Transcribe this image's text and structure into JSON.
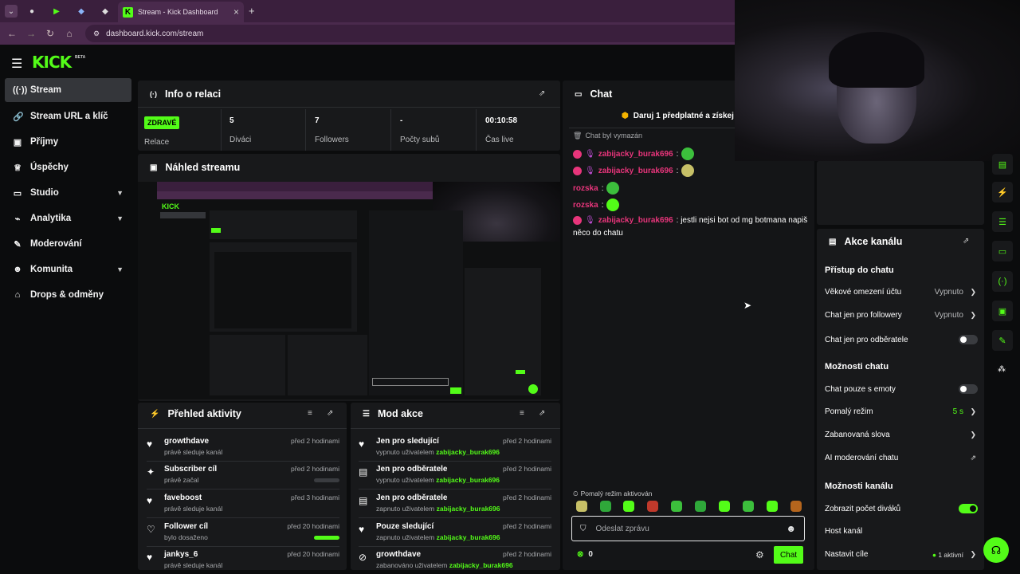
{
  "browser": {
    "tab_title": "Stream - Kick Dashboard",
    "url": "dashboard.kick.com/stream",
    "new_tab": "+",
    "close_tab": "×"
  },
  "app": {
    "logo": "KICK",
    "beta": "BETA"
  },
  "sidebar": {
    "items": [
      {
        "label": "Stream",
        "icon": "broadcast-icon"
      },
      {
        "label": "Stream URL a klíč",
        "icon": "link-icon"
      },
      {
        "label": "Příjmy",
        "icon": "wallet-icon"
      },
      {
        "label": "Úspěchy",
        "icon": "trophy-icon"
      },
      {
        "label": "Studio",
        "icon": "studio-icon"
      },
      {
        "label": "Analytika",
        "icon": "chart-icon"
      },
      {
        "label": "Moderování",
        "icon": "wrench-icon"
      },
      {
        "label": "Komunita",
        "icon": "people-icon"
      },
      {
        "label": "Drops & odměny",
        "icon": "gift-icon"
      }
    ]
  },
  "info": {
    "title": "Info o relaci",
    "status": "ZDRAVÉ",
    "status_label": "Relace",
    "stats": [
      {
        "value": "5",
        "label": "Diváci"
      },
      {
        "value": "7",
        "label": "Followers"
      },
      {
        "value": "-",
        "label": "Počty subů"
      },
      {
        "value": "00:10:58",
        "label": "Čas live"
      }
    ]
  },
  "preview": {
    "title": "Náhled streamu"
  },
  "activity": {
    "title": "Přehled aktivity",
    "rows": [
      {
        "title": "growthdave",
        "sub": "právě sleduje kanál",
        "time": "před 2 hodinami"
      },
      {
        "title": "Subscriber cíl",
        "sub": "právě začal",
        "time": "před 2 hodinami"
      },
      {
        "title": "faveboost",
        "sub": "právě sleduje kanál",
        "time": "před 3 hodinami"
      },
      {
        "title": "Follower cíl",
        "sub": "bylo dosaženo",
        "time": "před 20 hodinami"
      },
      {
        "title": "jankys_6",
        "sub": "právě sleduje kanál",
        "time": "před 20 hodinami"
      }
    ]
  },
  "modactions": {
    "title": "Mod akce",
    "rows": [
      {
        "title": "Jen pro sledující",
        "sub": "vypnuto uživatelem",
        "user": "zabijacky_burak696",
        "time": "před 2 hodinami"
      },
      {
        "title": "Jen pro odběratele",
        "sub": "vypnuto uživatelem",
        "user": "zabijacky_burak696",
        "time": "před 2 hodinami"
      },
      {
        "title": "Jen pro odběratele",
        "sub": "zapnuto uživatelem",
        "user": "zabijacky_burak696",
        "time": "před 2 hodinami"
      },
      {
        "title": "Pouze sledující",
        "sub": "zapnuto uživatelem",
        "user": "zabijacky_burak696",
        "time": "před 2 hodinami"
      },
      {
        "title": "growthdave",
        "sub": "zabanováno uživatelem",
        "user": "zabijacky_burak696",
        "time": "před 2 hodinami"
      }
    ]
  },
  "chat": {
    "title": "Chat",
    "promo": "Daruj 1 předplatné a získej 1.",
    "cleared": "Chat byl vymazán",
    "messages": [
      {
        "user": "zabijacky_burak696",
        "text": ":"
      },
      {
        "user": "zabijacky_burak696",
        "text": ":"
      },
      {
        "user": "rozska",
        "text": ":"
      },
      {
        "user": "rozska",
        "text": ":"
      },
      {
        "user": "zabijacky_burak696",
        "text": ": jestli nejsi bot od mg botmana napiš"
      }
    ],
    "message_cont": "něco do chatu",
    "slowmode_note": "Pomalý režim aktivován",
    "input_placeholder": "Odeslat zprávu",
    "points": "0",
    "send_label": "Chat"
  },
  "channel_actions": {
    "title": "Akce kanálu",
    "section1": "Přístup do chatu",
    "age": {
      "label": "Věkové omezení účtu",
      "value": "Vypnuto"
    },
    "followers_only": {
      "label": "Chat jen pro followery",
      "value": "Vypnuto"
    },
    "subs_only": {
      "label": "Chat jen pro odběratele"
    },
    "section2": "Možnosti chatu",
    "emote_only": {
      "label": "Chat pouze s emoty"
    },
    "slow_mode": {
      "label": "Pomalý režim",
      "value": "5 s"
    },
    "banned_words": {
      "label": "Zabanovaná slova"
    },
    "ai_mod": {
      "label": "AI moderování chatu"
    },
    "section3": "Možnosti kanálu",
    "show_viewers": {
      "label": "Zobrazit počet diváků"
    },
    "host": {
      "label": "Host kanál"
    },
    "goals": {
      "label": "Nastavit cíle",
      "value": "1 aktivní"
    }
  },
  "colors": {
    "accent": "#53fc18",
    "panel": "#18191b",
    "bg": "#0b0c0d",
    "chat_user": "#e8357b"
  }
}
